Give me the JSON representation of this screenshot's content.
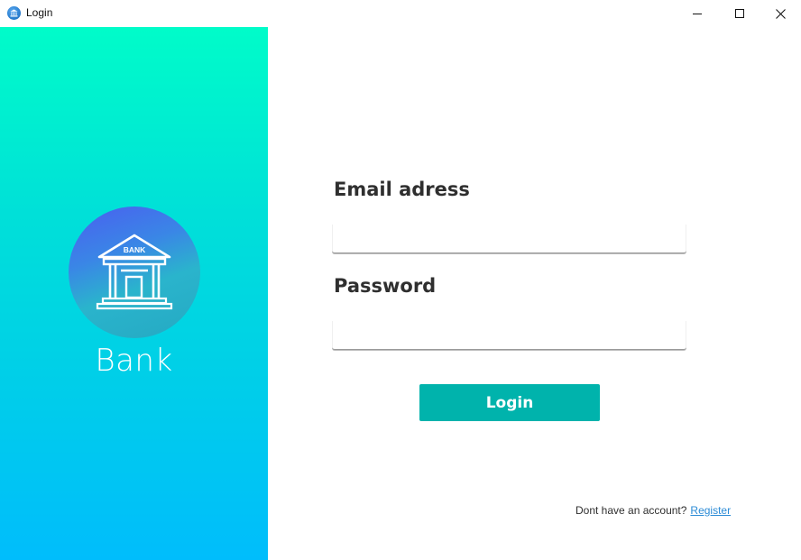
{
  "window": {
    "title": "Login",
    "app_icon": "bank-icon",
    "controls": {
      "minimize_icon": "minimize-icon",
      "maximize_icon": "maximize-icon",
      "close_icon": "close-icon"
    }
  },
  "brand": {
    "logo_text": "BANK",
    "name": "Bank",
    "logo_icon": "bank-building-icon",
    "gradient_top": "#00fcc9",
    "gradient_bottom": "#00bdfc"
  },
  "form": {
    "email_label": "Email adress",
    "email_value": "",
    "password_label": "Password",
    "password_value": "",
    "login_label": "Login",
    "button_color": "#00b3ac"
  },
  "footer": {
    "prompt": "Dont have an account?",
    "register_label": "Register",
    "link_color": "#2b8bd6"
  }
}
